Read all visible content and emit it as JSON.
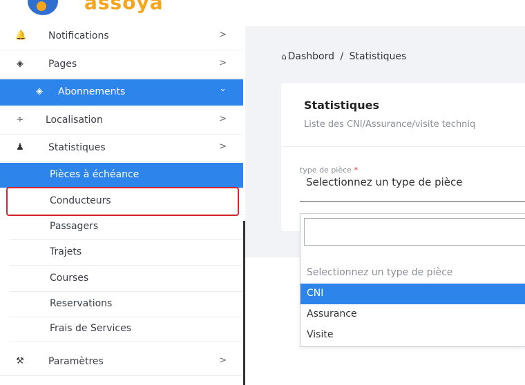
{
  "logo": {
    "text": "assoya"
  },
  "sidebar": {
    "items": [
      {
        "label": "Notifications",
        "icon": "bell-icon",
        "chevron": ">"
      },
      {
        "label": "Pages",
        "icon": "tags-icon",
        "chevron": ">"
      },
      {
        "label": "Abonnements",
        "icon": "tags-icon",
        "chevron": "⌄",
        "active": true
      },
      {
        "label": "Localisation",
        "icon": "rss-icon",
        "chevron": ">"
      },
      {
        "label": "Statistiques",
        "icon": "user-icon",
        "chevron": ">"
      },
      {
        "label": "Paramètres",
        "icon": "wrench-icon",
        "chevron": ">"
      }
    ],
    "sub_items": [
      {
        "label": "Pièces à échéance",
        "active": true
      },
      {
        "label": "Conducteurs"
      },
      {
        "label": "Passagers"
      },
      {
        "label": "Trajets"
      },
      {
        "label": "Courses"
      },
      {
        "label": "Reservations"
      },
      {
        "label": "Frais de Services"
      }
    ]
  },
  "breadcrumb": {
    "home": "Dashbord",
    "separator": "/",
    "current": "Statistiques"
  },
  "card": {
    "title": "Statistiques",
    "subtitle": "Liste des CNI/Assurance/visite techniq"
  },
  "form": {
    "field_label": "type de pièce",
    "required_mark": "*",
    "selected_value": "Selectionnez un type de pièce"
  },
  "dropdown": {
    "search_value": "",
    "options": [
      {
        "label": "Selectionnez un type de pièce",
        "placeholder": true
      },
      {
        "label": "CNI",
        "selected": true
      },
      {
        "label": "Assurance"
      },
      {
        "label": "Visite"
      }
    ]
  },
  "colors": {
    "accent": "#2d84ea",
    "logo_orange": "#f7a51c",
    "annotation_red": "#d9232a"
  }
}
